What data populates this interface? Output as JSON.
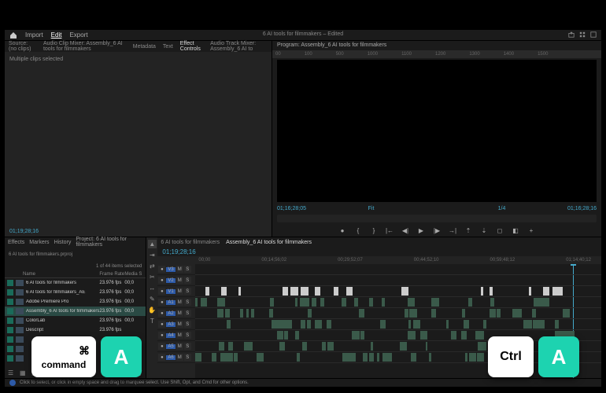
{
  "window": {
    "title": "6 AI tools for filmmakers – Edited"
  },
  "topmenu": {
    "import": "Import",
    "edit": "Edit",
    "export": "Export"
  },
  "source_tabs": {
    "source": "Source: (no clips)",
    "audio_clip": "Audio Clip Mixer: Assembly_6 AI tools for filmmakers",
    "metadata": "Metadata",
    "text": "Text",
    "effect_controls": "Effect Controls",
    "audio_track": "Audio Track Mixer: Assembly_6 AI to"
  },
  "source_body": "Multiple clips selected",
  "source_time": "01;19;28;16",
  "program": {
    "label": "Program: Assembly_6 AI tools for filmmakers",
    "time_left": "01;16;28;05",
    "fit": "Fit",
    "zoom": "1/4",
    "time_right": "01;16;28;16"
  },
  "ruler": [
    "00",
    "100",
    "500",
    "1000",
    "1100",
    "1200",
    "1300",
    "1400",
    "1500"
  ],
  "project": {
    "tabs": {
      "effects": "Effects",
      "markers": "Markers",
      "history": "History",
      "project": "Project: 6 AI tools for filmmakers"
    },
    "file": "6 AI tools for filmmakers.prproj",
    "count": "1 of 44 items selected",
    "cols": {
      "name": "Name",
      "fr": "Frame Rate",
      "ms": "Media S"
    },
    "rows": [
      {
        "name": "6 AI tools for filmmakers",
        "fr": "23.976 fps",
        "ms": "00;0"
      },
      {
        "name": "6 AI tools for filmmakers_AE",
        "fr": "23.976 fps",
        "ms": "00;0"
      },
      {
        "name": "Adobe Premiere Pro",
        "fr": "23.976 fps",
        "ms": "00;0"
      },
      {
        "name": "Assembly_6 AI tools for filmmakers",
        "fr": "23.976 fps",
        "ms": "00;0",
        "hl": true
      },
      {
        "name": "ColorLab",
        "fr": "23.976 fps",
        "ms": "00;0"
      },
      {
        "name": "Descript",
        "fr": "23.976 fps",
        "ms": ""
      },
      {
        "name": "",
        "fr": "",
        "ms": ""
      },
      {
        "name": "",
        "fr": "",
        "ms": ""
      },
      {
        "name": "",
        "fr": "",
        "ms": ""
      }
    ]
  },
  "timeline": {
    "tabs": {
      "t1": "6 AI tools for filmmakers",
      "t2": "Assembly_6 AI tools for filmmakers"
    },
    "time": "01;19;28;16",
    "ruler": [
      "00;00",
      "00;14;56;02",
      "00;29;52;07",
      "00;44;52;10",
      "00;59;48;12",
      "01;14;40;12"
    ],
    "vtracks": [
      "V3",
      "V2",
      "V1"
    ],
    "atracks": [
      "A1",
      "A2",
      "A3",
      "A4",
      "A5",
      "A6"
    ],
    "head_btns": {
      "mute": "M",
      "solo": "S",
      "eye": "●"
    }
  },
  "status": "Click to select, or click in empty space and drag to marquee select. Use Shift, Opt, and Cmd for other options.",
  "shortcuts": {
    "cmd": "command",
    "ctrl": "Ctrl",
    "a": "A",
    "cmdSym": "⌘"
  }
}
